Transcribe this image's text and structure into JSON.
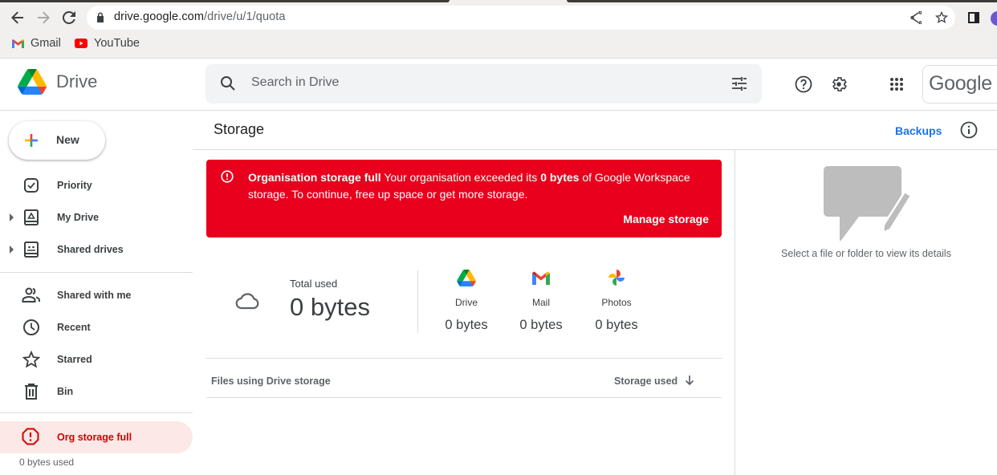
{
  "browser": {
    "url_host": "drive.google.com",
    "url_path": "/drive/u/1/quota",
    "bookmarks": [
      {
        "label": "Gmail",
        "icon": "gmail-icon"
      },
      {
        "label": "YouTube",
        "icon": "youtube-icon"
      }
    ]
  },
  "header": {
    "app_name": "Drive",
    "search_placeholder": "Search in Drive",
    "account_brand": "Google"
  },
  "sidebar": {
    "new_label": "New",
    "items": [
      {
        "label": "Priority",
        "icon": "priority-icon",
        "expandable": false
      },
      {
        "label": "My Drive",
        "icon": "my-drive-icon",
        "expandable": true
      },
      {
        "label": "Shared drives",
        "icon": "shared-drives-icon",
        "expandable": true
      },
      {
        "label": "Shared with me",
        "icon": "shared-with-me-icon",
        "expandable": false
      },
      {
        "label": "Recent",
        "icon": "clock-icon",
        "expandable": false
      },
      {
        "label": "Starred",
        "icon": "star-icon",
        "expandable": false
      },
      {
        "label": "Bin",
        "icon": "trash-icon",
        "expandable": false
      }
    ],
    "storage_status": "Org storage full",
    "storage_used": "0 bytes used"
  },
  "main": {
    "title": "Storage",
    "backups_label": "Backups",
    "alert": {
      "title": "Organisation storage full",
      "text_before": " Your organisation exceeded its ",
      "quota": "0 bytes",
      "text_after": " of Google Workspace storage. To continue, free up space or get more storage.",
      "action": "Manage storage",
      "color": "#e8001c"
    },
    "total": {
      "label": "Total used",
      "value": "0 bytes"
    },
    "services": [
      {
        "name": "Drive",
        "value": "0 bytes"
      },
      {
        "name": "Mail",
        "value": "0 bytes"
      },
      {
        "name": "Photos",
        "value": "0 bytes"
      }
    ],
    "table": {
      "col_files": "Files using Drive storage",
      "col_storage": "Storage used"
    }
  },
  "details": {
    "empty_text": "Select a file or folder to view its details"
  }
}
